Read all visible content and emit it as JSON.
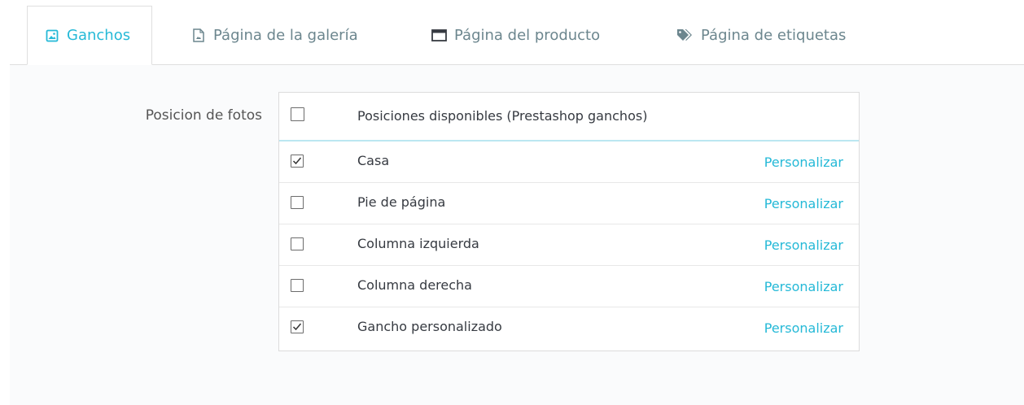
{
  "tabs": [
    {
      "label": "Ganchos",
      "icon": "image-icon",
      "active": true
    },
    {
      "label": "Página de la galería",
      "icon": "file-image-icon",
      "active": false
    },
    {
      "label": "Página del producto",
      "icon": "window-icon",
      "active": false
    },
    {
      "label": "Página de etiquetas",
      "icon": "tags-icon",
      "active": false
    }
  ],
  "form": {
    "field_label": "Posicion de fotos",
    "table": {
      "header": "Posiciones disponibles (Prestashop ganchos)",
      "header_checked": false,
      "rows": [
        {
          "name": "Casa",
          "checked": true,
          "action": "Personalizar"
        },
        {
          "name": "Pie de página",
          "checked": false,
          "action": "Personalizar"
        },
        {
          "name": "Columna izquierda",
          "checked": false,
          "action": "Personalizar"
        },
        {
          "name": "Columna derecha",
          "checked": false,
          "action": "Personalizar"
        },
        {
          "name": "Gancho personalizado",
          "checked": true,
          "action": "Personalizar"
        }
      ]
    }
  },
  "colors": {
    "accent": "#25b9d7",
    "tab_inactive": "#6c868e",
    "text": "#363a41"
  }
}
